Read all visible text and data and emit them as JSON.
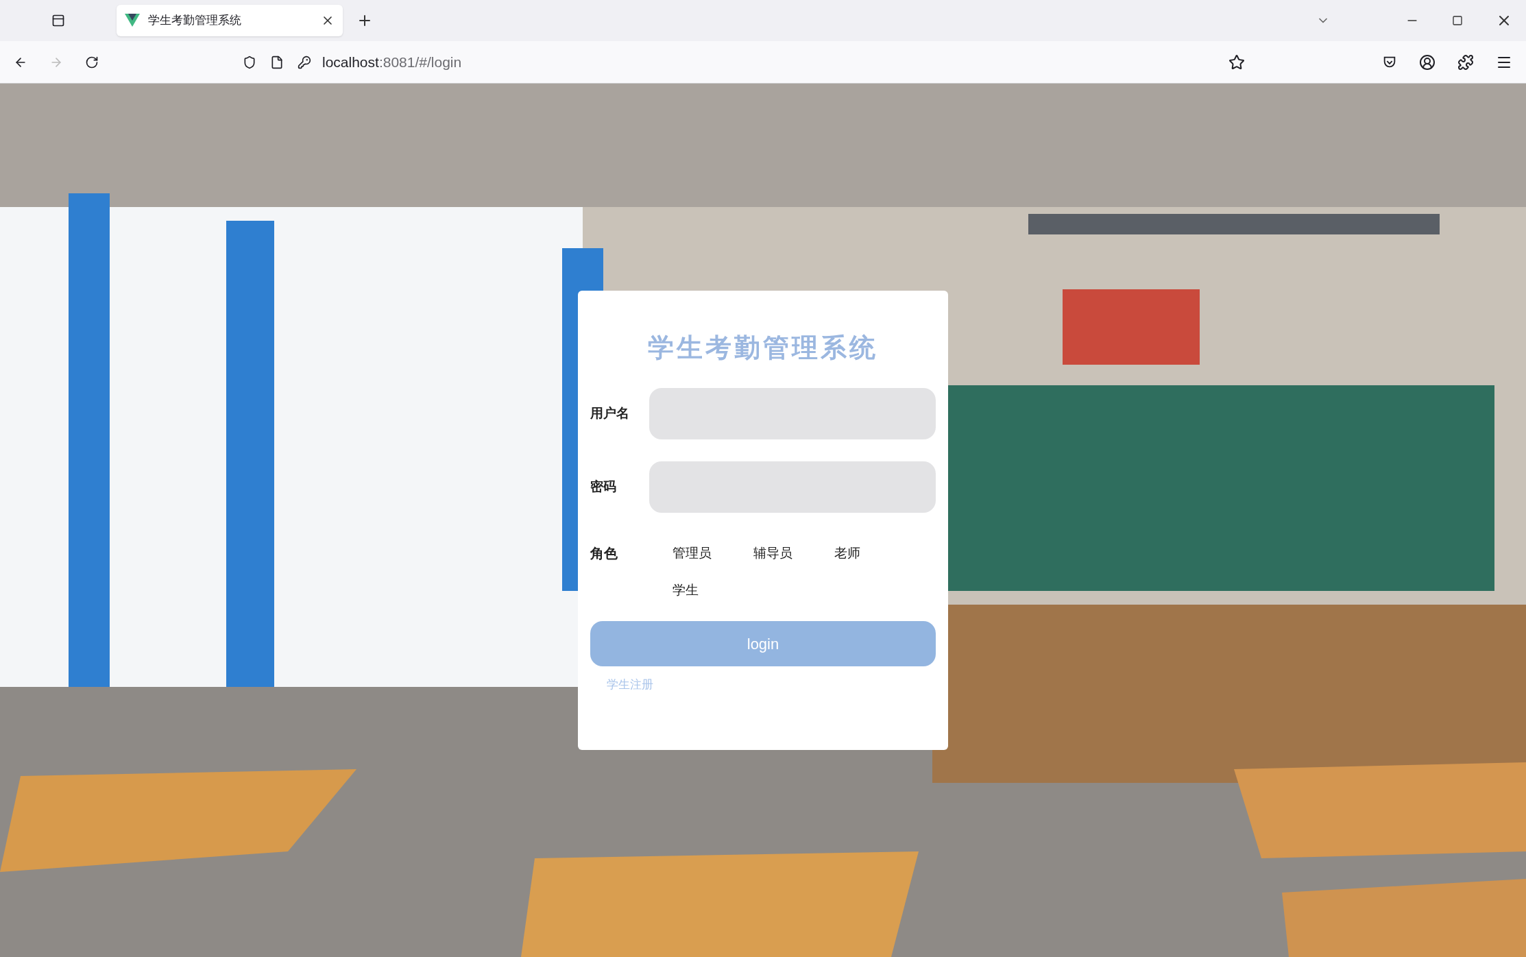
{
  "browser": {
    "tab_title": "学生考勤管理系统",
    "url_host": "localhost",
    "url_rest": ":8081/#/login"
  },
  "login": {
    "title": "学生考勤管理系统",
    "fields": [
      {
        "label": "用户名"
      },
      {
        "label": "密码"
      }
    ],
    "role_label": "角色",
    "roles": [
      "管理员",
      "辅导员",
      "老师",
      "学生"
    ],
    "button": "login",
    "link": "学生注册"
  }
}
